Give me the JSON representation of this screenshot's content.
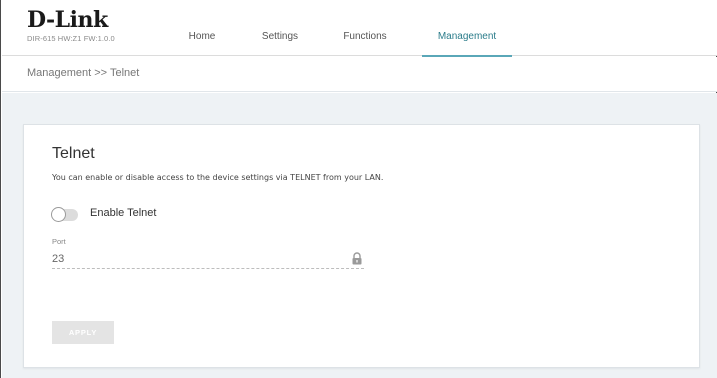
{
  "brand": {
    "logo_text": "D-Link",
    "model_info": "DIR-615 HW:Z1 FW:1.0.0"
  },
  "nav": {
    "items": [
      {
        "label": "Home"
      },
      {
        "label": "Settings"
      },
      {
        "label": "Functions"
      },
      {
        "label": "Management"
      }
    ],
    "active": "Management",
    "accent_color": "#5aa7b8"
  },
  "breadcrumb": "Management >> Telnet",
  "card": {
    "title": "Telnet",
    "description": "You can enable or disable access to the device settings via TELNET from your LAN.",
    "toggle": {
      "label": "Enable Telnet",
      "enabled": false
    },
    "port": {
      "label": "Port",
      "value": "23",
      "locked": true,
      "icon": "lock-icon"
    },
    "apply_label": "APPLY"
  }
}
